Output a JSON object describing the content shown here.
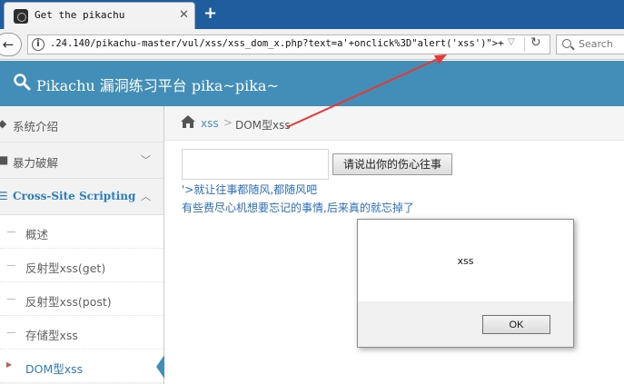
{
  "browser": {
    "tab_title": "Get the pikachu",
    "tab_close": "✕",
    "new_tab": "+",
    "url": ".24.140/pikachu-master/vul/xss/xss_dom_x.php?text=a'+onclick%3D\"alert('xss')\">+#",
    "search_placeholder": "Search"
  },
  "site": {
    "title": "Pikachu 漏洞练习平台 pika~pika~"
  },
  "sidebar": {
    "items": [
      {
        "label": "系统介绍",
        "icon": "tag-icon"
      },
      {
        "label": "暴力破解",
        "icon": "lock-icon",
        "chevron": "﹀"
      },
      {
        "label": "Cross-Site Scripting",
        "icon": "list-icon",
        "chevron": "︿"
      }
    ],
    "sub_items": [
      {
        "label": "概述"
      },
      {
        "label": "反射型xss(get)"
      },
      {
        "label": "反射型xss(post)"
      },
      {
        "label": "存储型xss"
      },
      {
        "label": "DOM型xss"
      }
    ]
  },
  "breadcrumb": {
    "link": "xss",
    "separator": ">",
    "current": "DOM型xss"
  },
  "main": {
    "input_value": "",
    "button_label": "请说出你的伤心往事",
    "line1": "'>就让往事都随风,都随风吧",
    "line2": "有些费尽心机想要忘记的事情,后来真的就忘掉了"
  },
  "dialog": {
    "message": "xss",
    "ok_label": "OK"
  },
  "colors": {
    "header": "#438eb9",
    "tabstrip": "#1f5d9e",
    "link": "#2a6fc4",
    "annotation_arrow": "#e53935"
  }
}
